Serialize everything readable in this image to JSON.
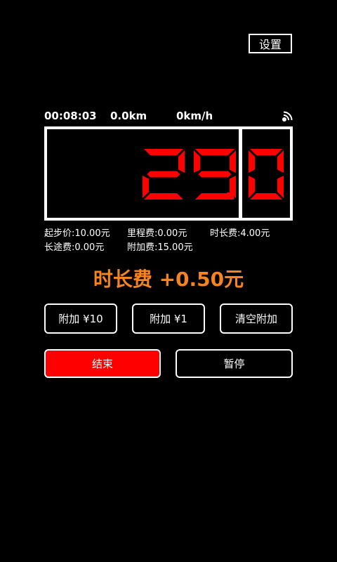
{
  "header": {
    "settings_label": "设置"
  },
  "stats": {
    "elapsed": "00:08:03",
    "distance": "0.0km",
    "speed": "0km/h",
    "gps_icon": "gps-signal-icon"
  },
  "meter": {
    "fare_digits": [
      "2",
      "9"
    ],
    "fare_decimal_digit": "0",
    "digit_color": "#ff0000"
  },
  "fees": {
    "base": "起步价:10.00元",
    "mileage": "里程费:0.00元",
    "duration": "时长费:4.00元",
    "long_distance": "长途费:0.00元",
    "surcharge": "附加费:15.00元"
  },
  "notice": {
    "text": "时长费 +0.50元",
    "color": "#f5831f"
  },
  "actions": {
    "add10": "附加 ¥10",
    "add1": "附加 ¥1",
    "clear": "清空附加",
    "end": "结束",
    "pause": "暂停"
  }
}
